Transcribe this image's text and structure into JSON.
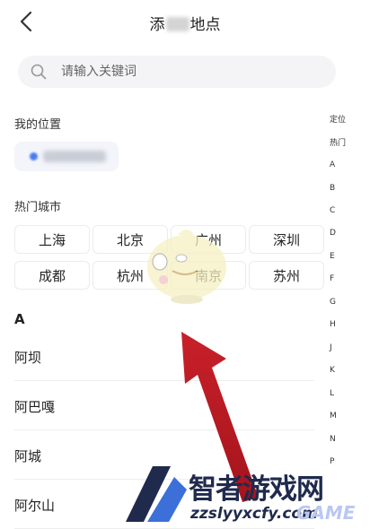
{
  "header": {
    "title_left": "添",
    "title_right": "地点"
  },
  "search": {
    "placeholder": "请输入关键词"
  },
  "my_location": {
    "label": "我的位置"
  },
  "hot_cities": {
    "label": "热门城市",
    "cities": [
      "上海",
      "北京",
      "广州",
      "深圳",
      "成都",
      "杭州",
      "南京",
      "苏州"
    ]
  },
  "section_letter": "A",
  "list": [
    "阿坝",
    "阿巴嘎",
    "阿城",
    "阿尔山"
  ],
  "index_bar": [
    "定位",
    "热门",
    "A",
    "B",
    "C",
    "D",
    "E",
    "F",
    "G",
    "H",
    "J",
    "K",
    "L",
    "M",
    "N",
    "P"
  ],
  "watermark": {
    "text": "智者游戏网",
    "url": "zzslyyxcfy.com",
    "tag": "GAME"
  }
}
